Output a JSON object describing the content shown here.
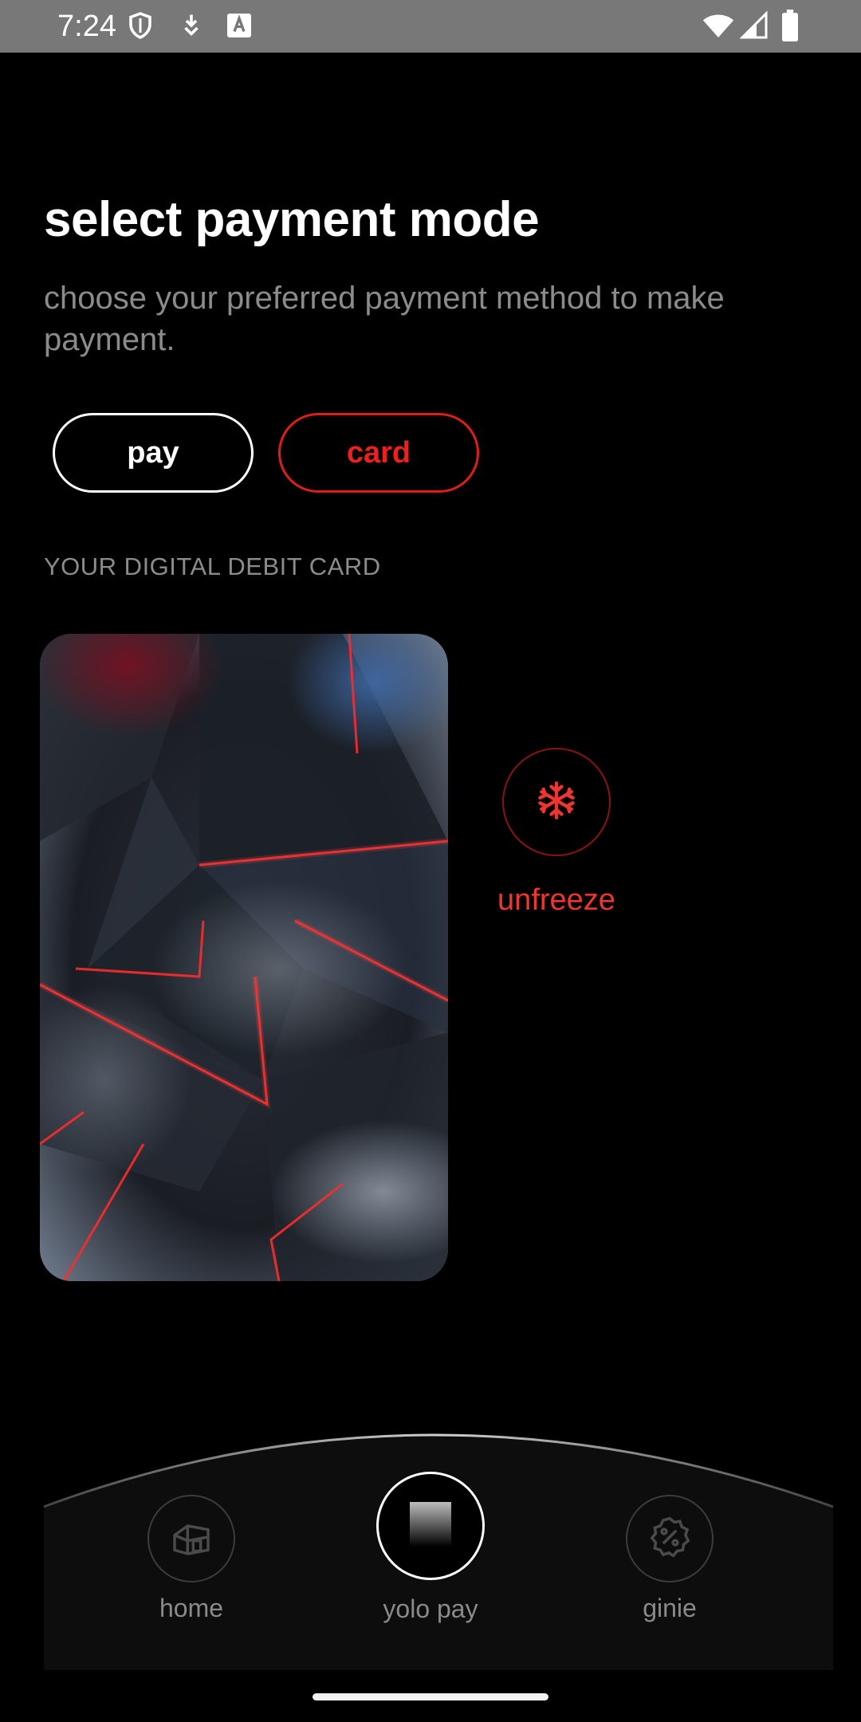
{
  "status_bar": {
    "time": "7:24",
    "icons_left": [
      "shield-icon",
      "download-icon",
      "font-app-icon"
    ],
    "icons_right": [
      "wifi-icon",
      "cell-signal-icon",
      "battery-icon"
    ]
  },
  "header": {
    "title": "select payment mode",
    "subtitle": "choose your preferred payment method to make payment."
  },
  "modes": {
    "pay_label": "pay",
    "card_label": "card",
    "selected": "card"
  },
  "card_section": {
    "label": "YOUR DIGITAL DEBIT CARD"
  },
  "freeze": {
    "label": "unfreeze",
    "icon": "snowflake-icon"
  },
  "bottom_nav": {
    "items": [
      {
        "label": "home",
        "icon": "home-icon"
      },
      {
        "label": "yolo pay",
        "icon": "card-icon"
      },
      {
        "label": "ginie",
        "icon": "discount-badge-icon"
      }
    ]
  },
  "colors": {
    "accent_red": "#f01f1f",
    "background": "#000000",
    "muted_text": "#8b8b8b"
  }
}
